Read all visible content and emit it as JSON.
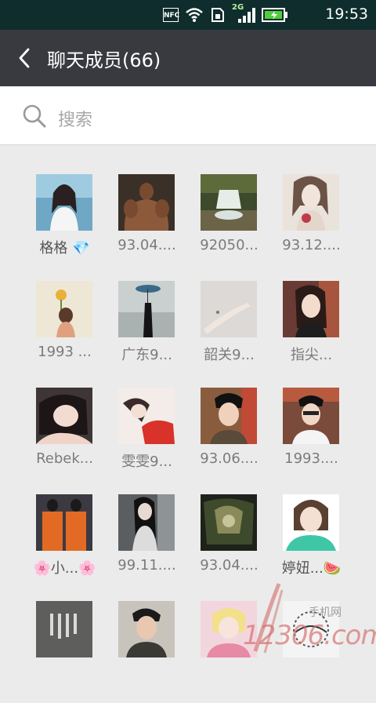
{
  "status_bar": {
    "nfc_label": "NFC",
    "network_label": "2G",
    "time": "19:53",
    "icons": [
      "nfc-icon",
      "wifi-icon",
      "sim-icon",
      "signal-icon",
      "battery-icon"
    ]
  },
  "header": {
    "title": "聊天成员(66)",
    "back_icon": "chevron-left-icon"
  },
  "search": {
    "placeholder": "搜索",
    "icon": "search-icon"
  },
  "members": [
    {
      "name": "格格 💎"
    },
    {
      "name": "93.04...."
    },
    {
      "name": "92050..."
    },
    {
      "name": "93.12...."
    },
    {
      "name": "1993 ..."
    },
    {
      "name": "广东9..."
    },
    {
      "name": "韶关9..."
    },
    {
      "name": "指尖..."
    },
    {
      "name": "Rebek..."
    },
    {
      "name": "雯雯9..."
    },
    {
      "name": "93.06...."
    },
    {
      "name": "1993...."
    },
    {
      "name": "🌸小...🌸"
    },
    {
      "name": "99.11...."
    },
    {
      "name": "93.04...."
    },
    {
      "name": "婷妞...🍉"
    },
    {
      "name": ""
    },
    {
      "name": ""
    },
    {
      "name": ""
    },
    {
      "name": ""
    }
  ],
  "watermark": {
    "text": "12306.com",
    "sub": "手机网"
  },
  "colors": {
    "status_bar": "#0f2d2c",
    "app_bar": "#393a3f",
    "background": "#ebebeb",
    "search_bg": "#ffffff"
  }
}
